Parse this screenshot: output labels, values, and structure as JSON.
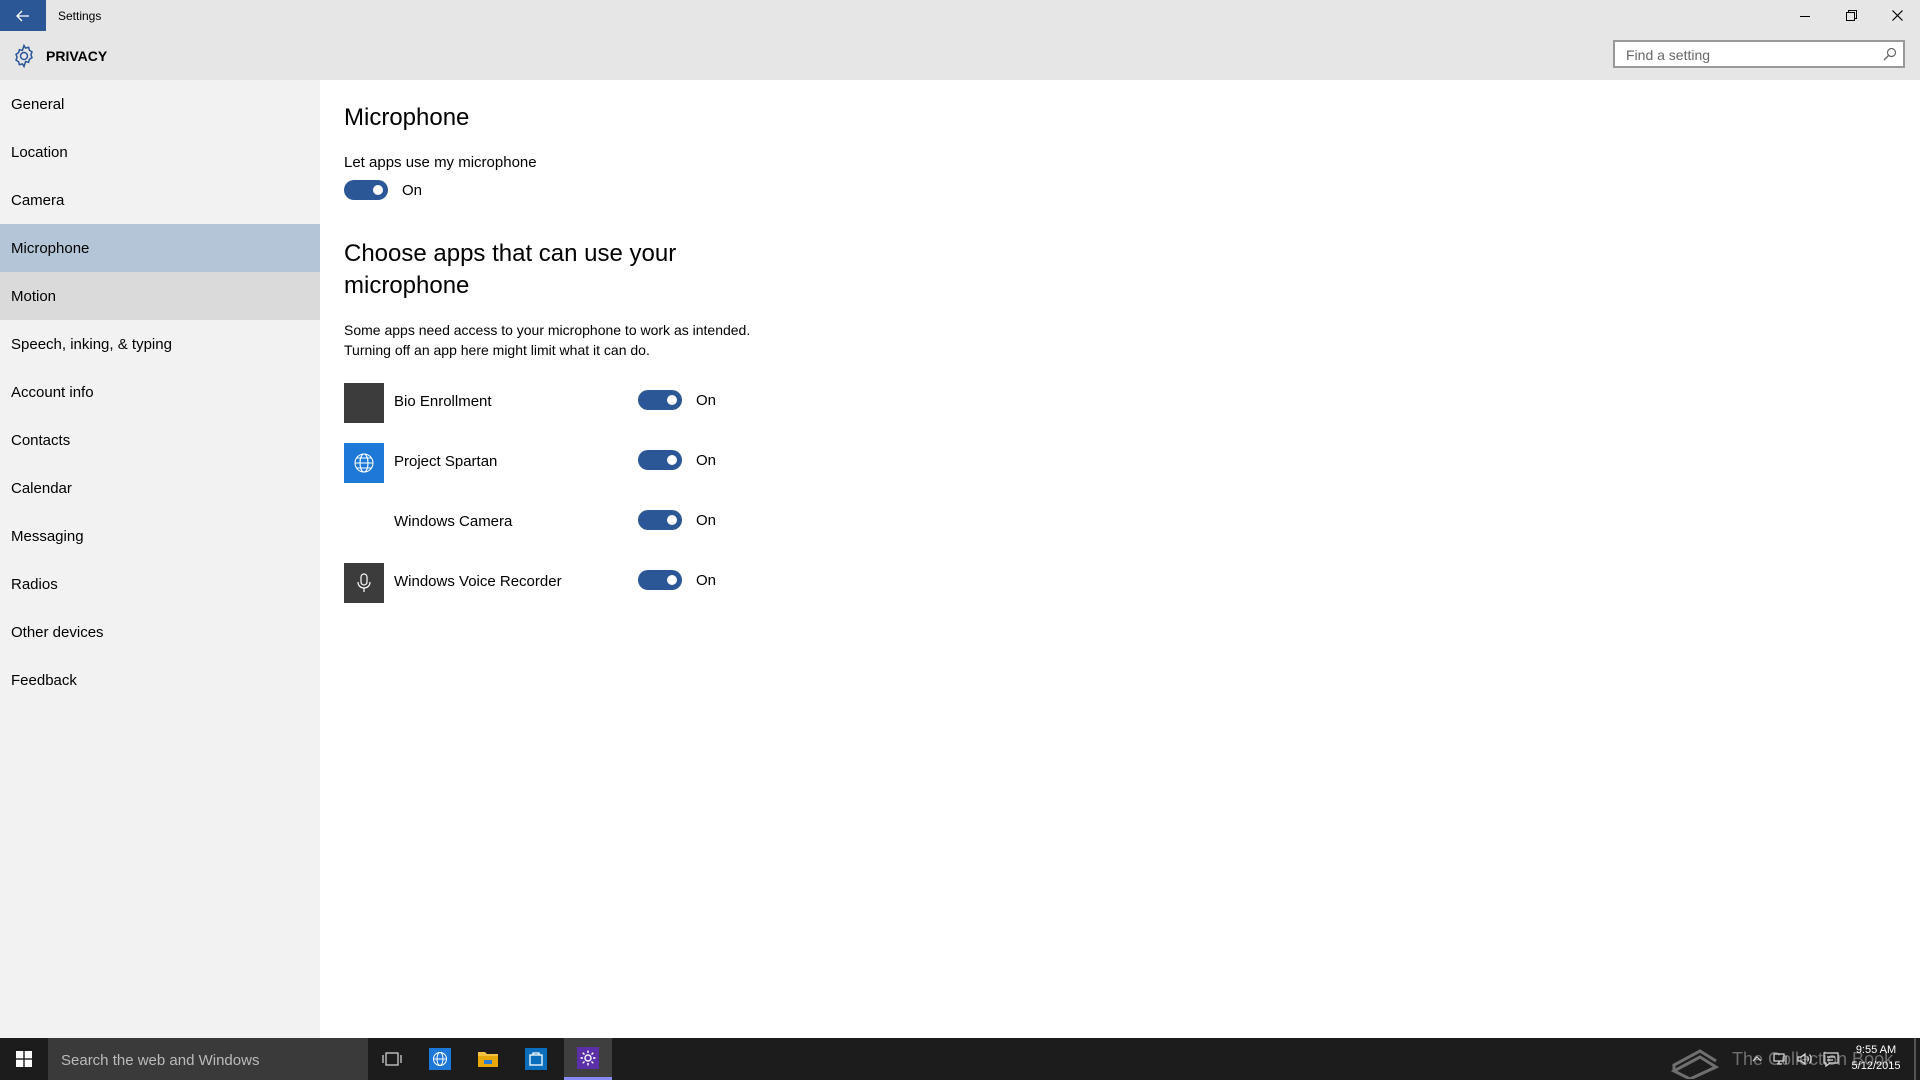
{
  "window": {
    "title": "Settings",
    "back_icon": "back-arrow-icon",
    "controls": [
      "minimize-icon",
      "restore-icon",
      "close-icon"
    ]
  },
  "header": {
    "icon": "gear-icon",
    "title": "PRIVACY",
    "search_placeholder": "Find a setting",
    "search_icon": "search-icon"
  },
  "sidebar": {
    "items": [
      {
        "label": "General"
      },
      {
        "label": "Location"
      },
      {
        "label": "Camera"
      },
      {
        "label": "Microphone",
        "state": "selected"
      },
      {
        "label": "Motion",
        "state": "hover"
      },
      {
        "label": "Speech, inking, & typing"
      },
      {
        "label": "Account info"
      },
      {
        "label": "Contacts"
      },
      {
        "label": "Calendar"
      },
      {
        "label": "Messaging"
      },
      {
        "label": "Radios"
      },
      {
        "label": "Other devices"
      },
      {
        "label": "Feedback"
      }
    ]
  },
  "main": {
    "title": "Microphone",
    "master_toggle": {
      "label": "Let apps use my microphone",
      "state": "On",
      "on": true
    },
    "section_title": "Choose apps that can use your microphone",
    "description": [
      "Some apps need access to your microphone to work as intended.",
      "Turning off an app here might limit what it can do."
    ],
    "apps": [
      {
        "name": "Bio Enrollment",
        "icon": "bio-enrollment-icon",
        "state": "On",
        "on": true
      },
      {
        "name": "Project Spartan",
        "icon": "globe-icon",
        "state": "On",
        "on": true
      },
      {
        "name": "Windows Camera",
        "icon": "",
        "state": "On",
        "on": true
      },
      {
        "name": "Windows Voice Recorder",
        "icon": "microphone-icon",
        "state": "On",
        "on": true
      }
    ]
  },
  "taskbar": {
    "search_placeholder": "Search the web and Windows",
    "pinned": [
      "task-view-icon",
      "browser-icon",
      "file-explorer-icon",
      "store-icon",
      "settings-icon"
    ],
    "active": "settings-icon",
    "watermark": "The Collection Book",
    "tray": [
      "chevron-up-icon",
      "network-icon",
      "volume-icon",
      "notification-icon"
    ],
    "time": "9:55 AM",
    "date": "5/12/2015"
  },
  "colors": {
    "accent": "#2b5797",
    "selected_nav": "#b5c5d8",
    "hover_nav": "#dadada",
    "chrome": "#e6e6e6",
    "taskbar": "#1c1c1c"
  }
}
